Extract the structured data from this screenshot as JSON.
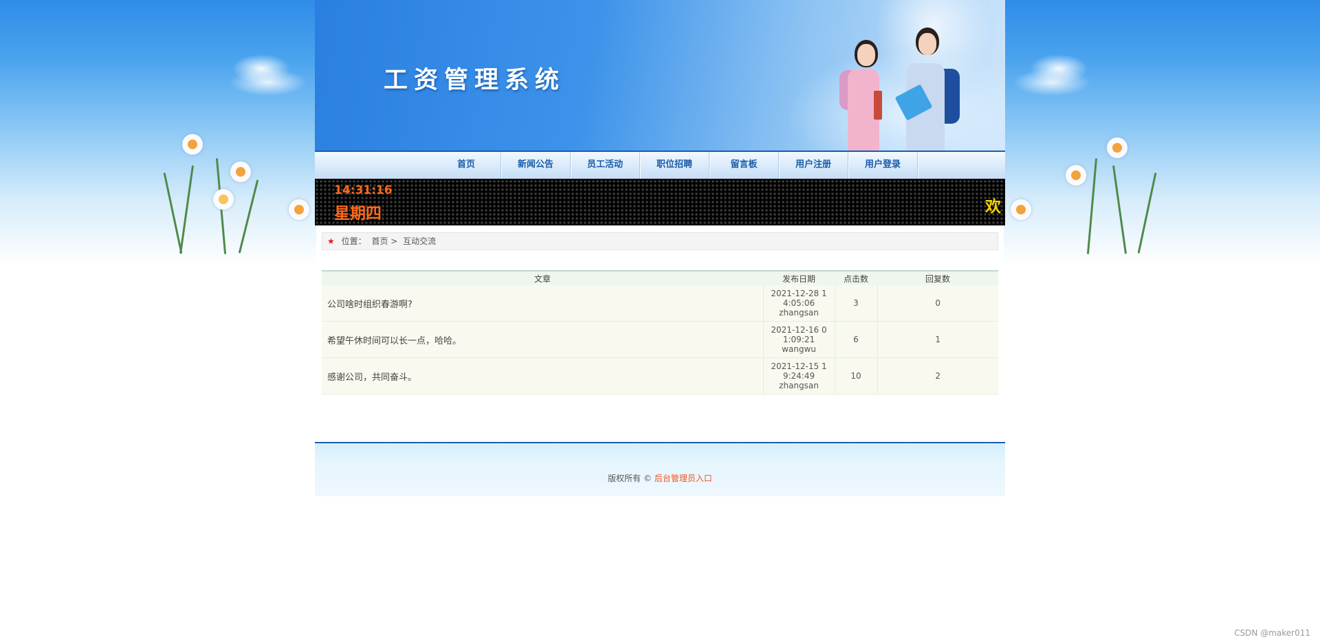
{
  "header": {
    "site_title": "工资管理系统"
  },
  "nav": {
    "items": [
      {
        "label": "首页"
      },
      {
        "label": "新闻公告"
      },
      {
        "label": "员工活动"
      },
      {
        "label": "职位招聘"
      },
      {
        "label": "留言板"
      },
      {
        "label": "用户注册"
      },
      {
        "label": "用户登录"
      }
    ]
  },
  "led": {
    "time": "14:31:16",
    "weekday": "星期四",
    "marquee": "欢"
  },
  "breadcrumb": {
    "prefix": "位置：",
    "home": "首页",
    "separator": ">",
    "current": "互动交流"
  },
  "table": {
    "headers": [
      "文章",
      "发布日期",
      "点击数",
      "回复数"
    ],
    "rows": [
      {
        "title": "公司啥时组织春游啊?",
        "date": "2021-12-28 14:05:06",
        "author": "zhangsan",
        "clicks": "3",
        "replies": "0"
      },
      {
        "title": "希望午休时间可以长一点，哈哈。",
        "date": "2021-12-16 01:09:21",
        "author": "wangwu",
        "clicks": "6",
        "replies": "1"
      },
      {
        "title": "感谢公司，共同奋斗。",
        "date": "2021-12-15 19:24:49",
        "author": "zhangsan",
        "clicks": "10",
        "replies": "2"
      }
    ]
  },
  "footer": {
    "copyright": "版权所有 ©",
    "admin_link": "后台管理员入口"
  },
  "watermark": "CSDN @maker011",
  "colors": {
    "nav_text": "#1a5ca8",
    "led_text": "#ff6a1a",
    "marquee_text": "#f5d400",
    "admin_link": "#f0561e"
  }
}
